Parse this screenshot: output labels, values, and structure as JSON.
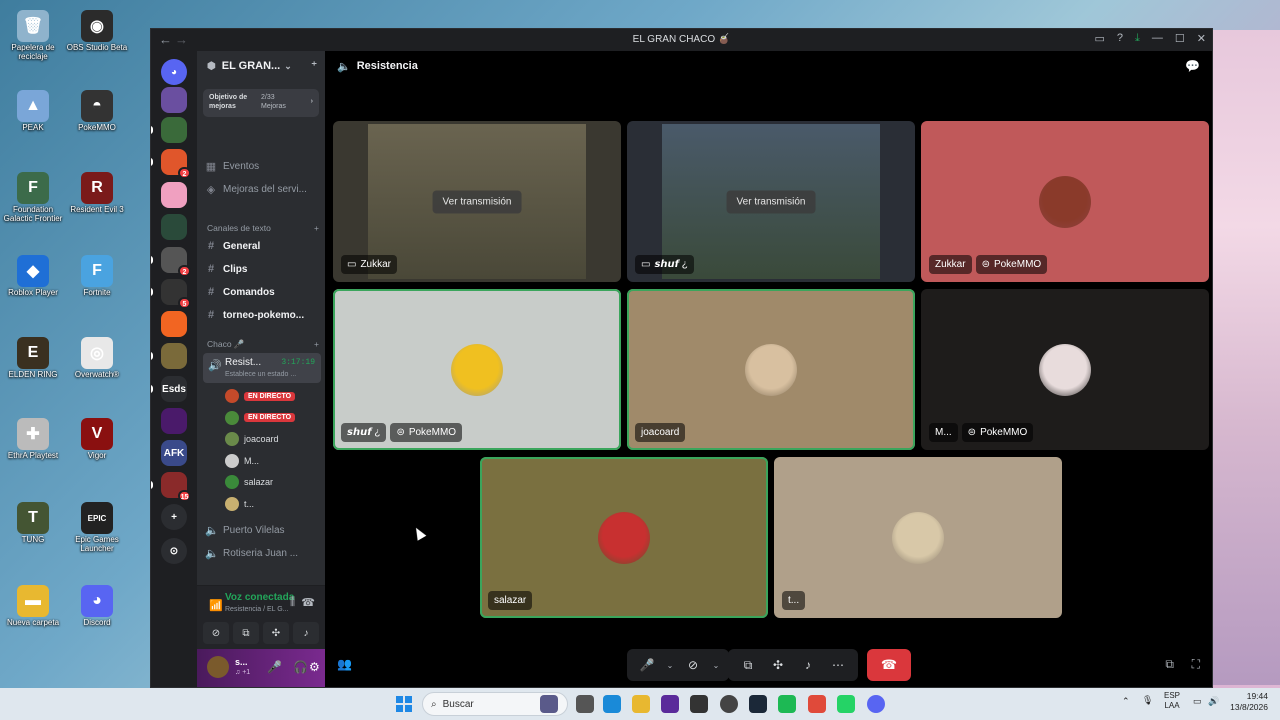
{
  "desktop": {
    "icons": [
      {
        "label": "Papelera de reciclaje",
        "color": "#8fb3cc",
        "glyph": "🗑"
      },
      {
        "label": "OBS Studio Beta",
        "color": "#2b2b2b",
        "glyph": "◉"
      },
      {
        "label": "PEAK",
        "color": "#7aa6d8",
        "glyph": "▲"
      },
      {
        "label": "PokeMMO",
        "color": "#333",
        "glyph": "◓"
      },
      {
        "label": "Foundation Galactic Frontier",
        "color": "#3c6b4a",
        "glyph": "F"
      },
      {
        "label": "Resident Evil 3",
        "color": "#7a1a1a",
        "glyph": "R"
      },
      {
        "label": "Roblox Player",
        "color": "#1f6fd6",
        "glyph": "◆"
      },
      {
        "label": "Fortnite",
        "color": "#4aa3e0",
        "glyph": "F"
      },
      {
        "label": "ELDEN RING",
        "color": "#3a3020",
        "glyph": "E"
      },
      {
        "label": "Overwatch®",
        "color": "#e8e8e8",
        "glyph": "◎"
      },
      {
        "label": "EthrA Playtest",
        "color": "#bbbbbb",
        "glyph": "✚"
      },
      {
        "label": "Vigor",
        "color": "#8a1010",
        "glyph": "V"
      },
      {
        "label": "TUNG",
        "color": "#445533",
        "glyph": "T"
      },
      {
        "label": "Epic Games Launcher",
        "color": "#222",
        "glyph": "EPIC"
      },
      {
        "label": "Nueva carpeta",
        "color": "#e8b830",
        "glyph": "▬"
      },
      {
        "label": "Discord",
        "color": "#5865f2",
        "glyph": "◕"
      }
    ]
  },
  "window": {
    "title": "EL GRAN CHACO 🧉"
  },
  "server_rail": [
    {
      "color": "#5865f2",
      "label": "◕",
      "badge": "",
      "pill": false
    },
    {
      "color": "#6a4fa0",
      "label": "",
      "badge": "",
      "pill": false
    },
    {
      "color": "#3a6a3a",
      "label": "",
      "badge": "",
      "pill": true
    },
    {
      "color": "#e0562b",
      "label": "",
      "badge": "2",
      "pill": true
    },
    {
      "color": "#f0a0c0",
      "label": "",
      "badge": "",
      "pill": false
    },
    {
      "color": "#2a4a3a",
      "label": "",
      "badge": "",
      "pill": false
    },
    {
      "color": "#555",
      "label": "",
      "badge": "2",
      "pill": true
    },
    {
      "color": "#333",
      "label": "",
      "badge": "5",
      "pill": true
    },
    {
      "color": "#f26522",
      "label": "",
      "badge": "",
      "pill": false
    },
    {
      "color": "#7a6a3a",
      "label": "",
      "badge": "",
      "pill": true
    },
    {
      "color": "#2b2d31",
      "label": "Esds",
      "badge": "",
      "pill": true
    },
    {
      "color": "#4a1a6a",
      "label": "",
      "badge": "",
      "pill": false
    },
    {
      "color": "#3a4a8a",
      "label": "AFK",
      "badge": "",
      "pill": false
    },
    {
      "color": "#8a2a2a",
      "label": "",
      "badge": "15",
      "pill": true
    },
    {
      "color": "#2b2d31",
      "label": "+",
      "badge": "",
      "pill": false
    },
    {
      "color": "#2b2d31",
      "label": "⊙",
      "badge": "",
      "pill": false
    }
  ],
  "sidebar": {
    "server_name": "EL GRAN...",
    "boost_goal_label": "Objetivo de mejoras",
    "boost_count": "2/33 Mejoras",
    "events": "Eventos",
    "server_boosts": "Mejoras del servi...",
    "text_category": "Canales de texto",
    "text_channels": [
      "General",
      "Clips",
      "Comandos",
      "torneo-pokemo..."
    ],
    "voice_category": "Chaco 🎤",
    "active_voice": {
      "name": "Resist...",
      "time": "3:17:19",
      "status": "Establece un estado ..."
    },
    "live_label": "EN DIRECTO",
    "members": [
      {
        "name": "",
        "live": true,
        "color": "#c44a2a"
      },
      {
        "name": "",
        "live": true,
        "color": "#4a8a3a"
      },
      {
        "name": "joacoard",
        "live": false,
        "color": "#6a8a4a"
      },
      {
        "name": "M...",
        "live": false,
        "color": "#ccc"
      },
      {
        "name": "salazar",
        "live": false,
        "color": "#3a8a3a"
      },
      {
        "name": "t...",
        "live": false,
        "color": "#c8b070"
      }
    ],
    "other_voice": [
      "Puerto Vilelas",
      "Rotiseria Juan ..."
    ],
    "voice_connected": "Voz conectada",
    "voice_location": "Resistencia / EL G...",
    "user": {
      "name": "s...",
      "sub": "♫ +1"
    }
  },
  "stage": {
    "channel": "Resistencia",
    "watch_label": "Ver transmisión",
    "game_label": "PokeMMO",
    "tiles": [
      {
        "name": "Zukkar",
        "type": "stream",
        "bg": "#3a3830"
      },
      {
        "name": "𝙨𝙝𝙪𝙛 ¿",
        "type": "stream",
        "bg": "#2a2e36"
      },
      {
        "name": "Zukkar",
        "type": "avatar",
        "bg": "#c0595a",
        "game": true,
        "av": "#8a3a2a"
      },
      {
        "name": "𝙨𝙝𝙪𝙛 ¿",
        "type": "avatar",
        "bg": "#c8ccc9",
        "game": true,
        "av": "#f0c020",
        "speaking": true
      },
      {
        "name": "joacoard",
        "type": "avatar",
        "bg": "#a08a6a",
        "game": false,
        "av": "#d8c0a0",
        "speaking": true
      },
      {
        "name": "M...",
        "type": "avatar",
        "bg": "#1e1c1b",
        "game": true,
        "av": "#e8dcdc"
      },
      {
        "name": "salazar",
        "type": "avatar",
        "bg": "#7a7040",
        "game": false,
        "av": "#c83030",
        "speaking": true
      },
      {
        "name": "t...",
        "type": "avatar",
        "bg": "#b0a08a",
        "game": false,
        "av": "#d8c8a8"
      }
    ]
  },
  "taskbar": {
    "search_placeholder": "Buscar",
    "lang": "ESP",
    "lang_sub": "LAA",
    "time": "19:44",
    "date": "13/8/2026"
  },
  "colors": {
    "accent": "#5865f2",
    "green": "#23a55a",
    "red": "#da373c"
  }
}
